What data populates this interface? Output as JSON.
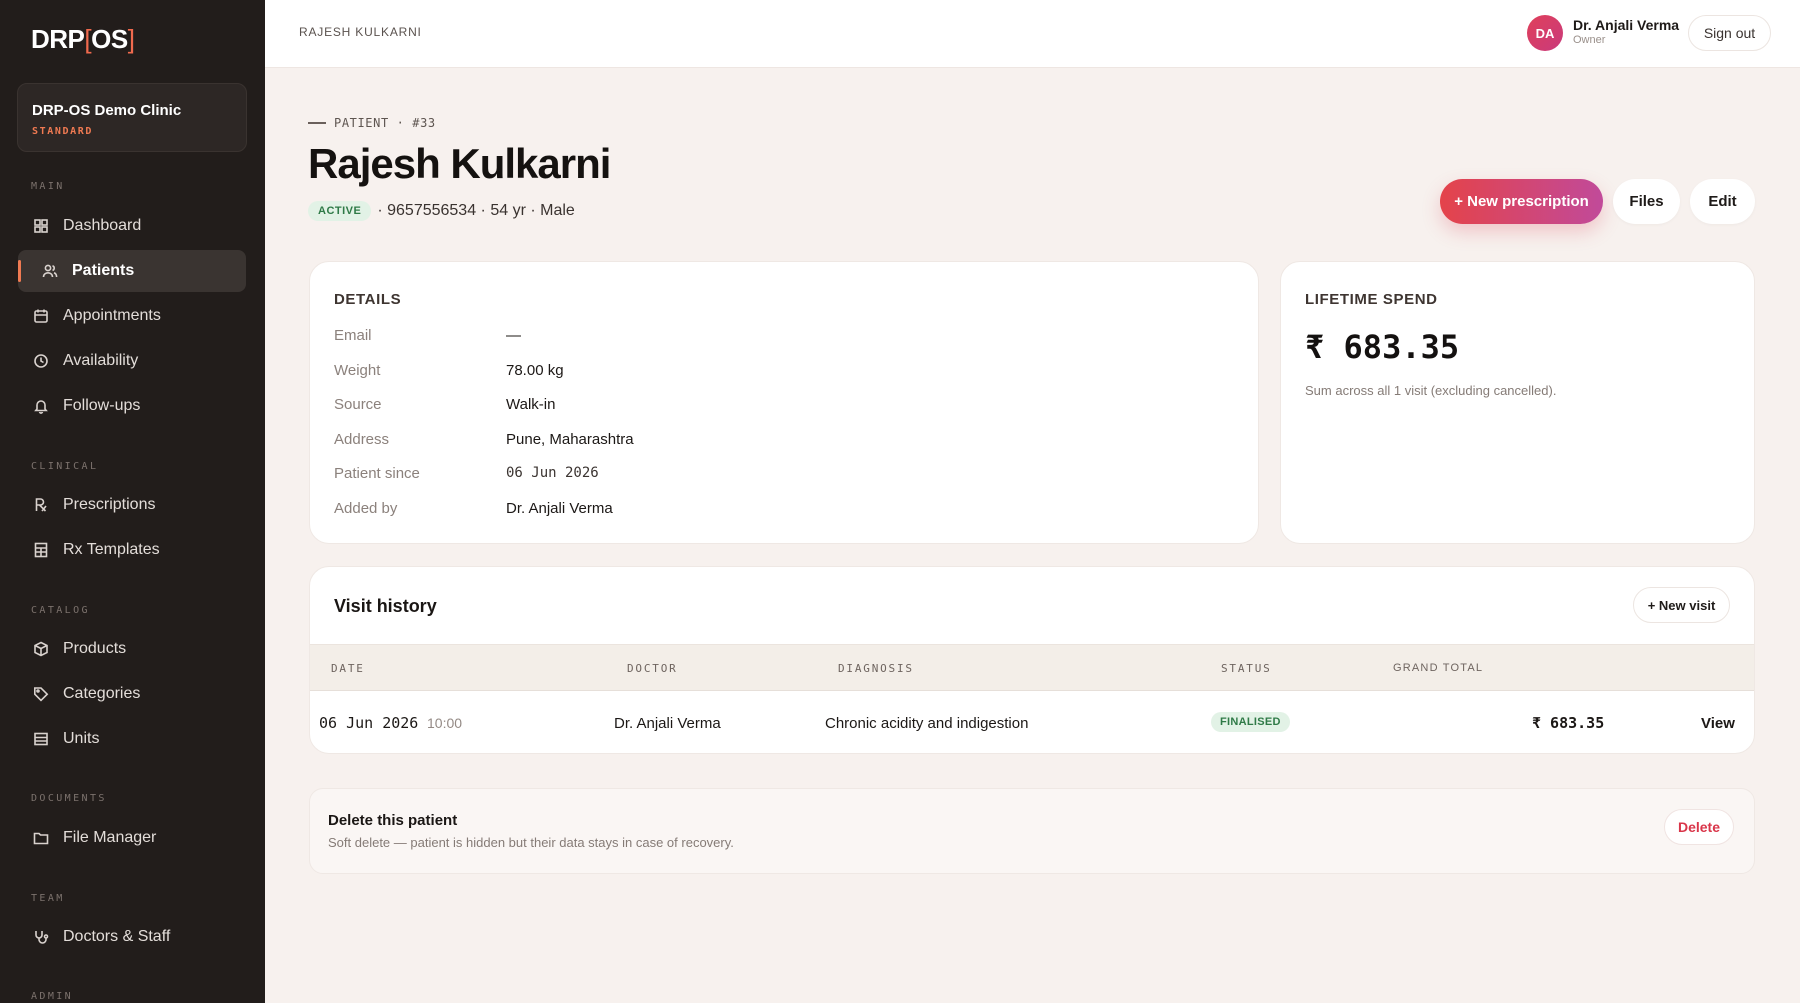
{
  "app": {
    "logo_main": "DRP",
    "logo_open": "[",
    "logo_os": "OS",
    "logo_close": "]",
    "clinic_name": "DRP-OS Demo Clinic",
    "clinic_plan": "STANDARD"
  },
  "sidebar": {
    "sections": {
      "main": "MAIN",
      "clinical": "CLINICAL",
      "catalog": "CATALOG",
      "documents": "DOCUMENTS",
      "team": "TEAM",
      "admin": "ADMIN"
    },
    "items": [
      {
        "label": "Dashboard",
        "icon": "grid-icon"
      },
      {
        "label": "Patients",
        "icon": "users-icon",
        "active": true
      },
      {
        "label": "Appointments",
        "icon": "calendar-icon"
      },
      {
        "label": "Availability",
        "icon": "clock-icon"
      },
      {
        "label": "Follow-ups",
        "icon": "bell-icon"
      },
      {
        "label": "Prescriptions",
        "icon": "rx-icon"
      },
      {
        "label": "Rx Templates",
        "icon": "template-icon"
      },
      {
        "label": "Products",
        "icon": "box-icon"
      },
      {
        "label": "Categories",
        "icon": "tag-icon"
      },
      {
        "label": "Units",
        "icon": "layers-icon"
      },
      {
        "label": "File Manager",
        "icon": "folder-icon"
      },
      {
        "label": "Doctors & Staff",
        "icon": "stethoscope-icon"
      }
    ]
  },
  "topbar": {
    "breadcrumb": "RAJESH KULKARNI",
    "avatar_initials": "DA",
    "user_name": "Dr. Anjali Verma",
    "user_role": "Owner",
    "signout_label": "Sign out"
  },
  "patient": {
    "eyebrow": "PATIENT · #33",
    "name": "Rajesh Kulkarni",
    "status": "ACTIVE",
    "meta": "· 9657556534 · 54 yr · Male"
  },
  "actions": {
    "new_prescription": "+ New prescription",
    "files": "Files",
    "edit": "Edit"
  },
  "details": {
    "title": "DETAILS",
    "rows": [
      {
        "label": "Email",
        "value": "—"
      },
      {
        "label": "Weight",
        "value": "78.00 kg"
      },
      {
        "label": "Source",
        "value": "Walk-in"
      },
      {
        "label": "Address",
        "value": "Pune, Maharashtra"
      },
      {
        "label": "Patient since",
        "value": "06 Jun 2026"
      },
      {
        "label": "Added by",
        "value": "Dr. Anjali Verma"
      }
    ]
  },
  "spend": {
    "title": "LIFETIME SPEND",
    "amount": "₹ 683.35",
    "note": "Sum across all 1 visit (excluding cancelled)."
  },
  "visits": {
    "title": "Visit history",
    "new_visit_label": "+ New visit",
    "columns": {
      "date": "DATE",
      "doctor": "DOCTOR",
      "diagnosis": "DIAGNOSIS",
      "status": "STATUS",
      "total": "GRAND TOTAL"
    },
    "rows": [
      {
        "date": "06 Jun 2026",
        "time": "10:00",
        "doctor": "Dr. Anjali Verma",
        "diagnosis": "Chronic acidity and indigestion",
        "status": "FINALISED",
        "total": "₹ 683.35",
        "action": "View"
      }
    ]
  },
  "danger": {
    "title": "Delete this patient",
    "subtitle": "Soft delete — patient is hidden but their data stays in case of recovery.",
    "delete_label": "Delete"
  },
  "colors": {
    "accent": "#f07a52",
    "sidebar_bg": "#221d1b",
    "page_bg": "#f7f1ee",
    "success": "#2f7a47",
    "danger": "#d9364a"
  }
}
